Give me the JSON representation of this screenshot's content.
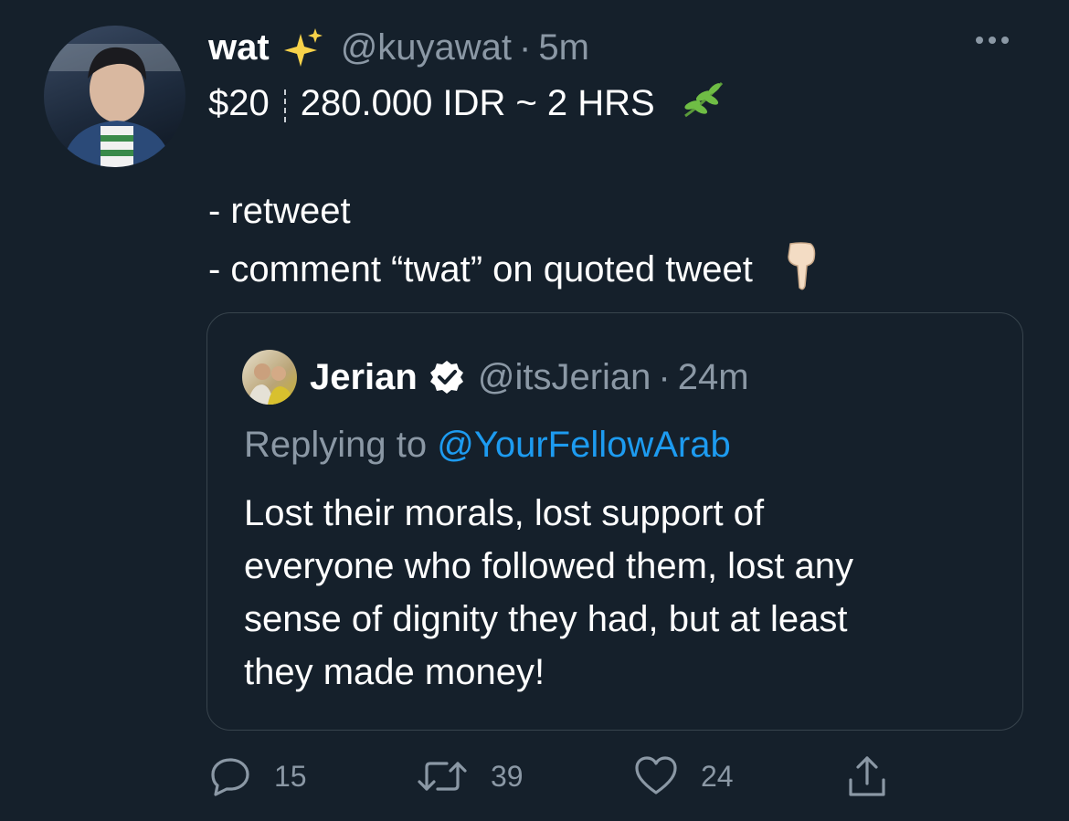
{
  "tweet": {
    "display_name": "wat",
    "handle": "@kuyawat",
    "time": "5m",
    "price": "$20",
    "rate": "280.000 IDR ~ 2 HRS",
    "lines": [
      "- retweet",
      "- comment “twat” on quoted tweet"
    ]
  },
  "quoted": {
    "display_name": "Jerian",
    "handle": "@itsJerian",
    "time": "24m",
    "replying_prefix": "Replying to ",
    "replying_to": "@YourFellowArab",
    "body": "Lost their morals, lost support of\neveryone who followed them, lost any\nsense of dignity they had, but at least\nthey made money!"
  },
  "actions": {
    "replies": "15",
    "retweets": "39",
    "likes": "24"
  },
  "icons": [
    "sparkles-icon",
    "herb-icon",
    "pointing-down-icon",
    "verified-badge-icon",
    "more-icon",
    "reply-icon",
    "retweet-icon",
    "like-icon",
    "share-icon"
  ],
  "colors": {
    "background": "#15202b",
    "text": "#ffffff",
    "muted": "#8b98a5",
    "link": "#1d9bf0",
    "border": "#38444d"
  }
}
